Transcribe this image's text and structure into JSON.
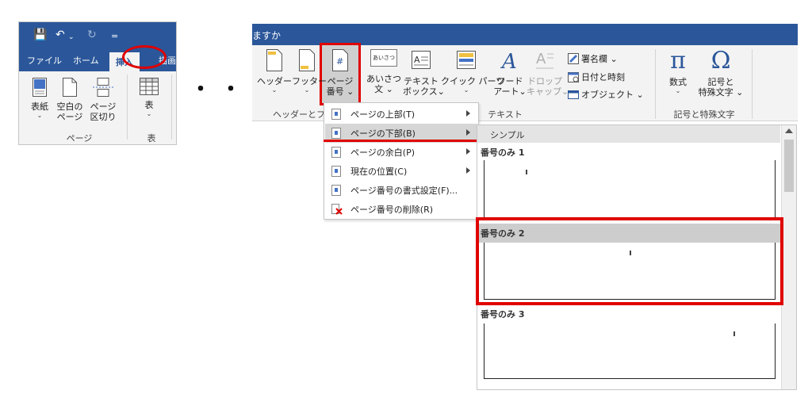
{
  "left_ribbon": {
    "qat": {
      "save_icon": "save-icon",
      "undo_icon": "undo-icon",
      "redo_icon": "redo-icon",
      "customize": "="
    },
    "tabs": [
      "ファイル",
      "ホーム",
      "挿入",
      "描画"
    ],
    "active_tab": "挿入",
    "commands": {
      "cover": [
        "表紙",
        "⌄"
      ],
      "blank": [
        "空白の",
        "ページ"
      ],
      "break": [
        "ページ",
        "区切り"
      ],
      "table": [
        "表",
        "⌄"
      ]
    },
    "groups": {
      "page": "ページ",
      "table": "表"
    }
  },
  "ellipsis": "・・・",
  "ribbon": {
    "tell_me": "ますか",
    "header": [
      "ヘッダー",
      "⌄"
    ],
    "footer": [
      "フッター",
      "⌄"
    ],
    "page_number": [
      "ページ",
      "番号 ⌄"
    ],
    "greeting": [
      "あいさつ",
      "文 ⌄"
    ],
    "textbox": [
      "テキスト",
      "ボックス⌄"
    ],
    "quickparts": [
      "クイック パーツ",
      "⌄"
    ],
    "wordart": [
      "ワード",
      "アート⌄"
    ],
    "dropcap": [
      "ドロップ",
      "キャップ⌄"
    ],
    "signature": "署名欄  ⌄",
    "datetime": "日付と時刻",
    "object": "オブジェクト  ⌄",
    "equation": [
      "数式",
      "⌄"
    ],
    "symbol": [
      "記号と",
      "特殊文字 ⌄"
    ],
    "groups": {
      "header_footer": "ヘッダーとフッ",
      "text": "テキスト",
      "symbols": "記号と特殊文字"
    },
    "greeting_icon_text": "あいさつ",
    "pi": "π",
    "omega": "Ω",
    "hash": "#"
  },
  "menu": {
    "items": [
      {
        "label": "ページの上部(T)",
        "submenu": true
      },
      {
        "label": "ページの下部(B)",
        "submenu": true
      },
      {
        "label": "ページの余白(P)",
        "submenu": true
      },
      {
        "label": "現在の位置(C)",
        "submenu": true
      },
      {
        "label": "ページ番号の書式設定(F)...",
        "submenu": false
      },
      {
        "label": "ページ番号の削除(R)",
        "submenu": false
      }
    ],
    "hovered_index": 1
  },
  "gallery": {
    "header": "シンプル",
    "items": [
      {
        "label": "番号のみ 1",
        "position": "left"
      },
      {
        "label": "番号のみ 2",
        "position": "center",
        "selected": true
      },
      {
        "label": "番号のみ 3",
        "position": "right"
      }
    ]
  },
  "colors": {
    "accent": "#2b579a",
    "highlight": "#e00000",
    "ribbon_bg": "#f3f3f3"
  }
}
